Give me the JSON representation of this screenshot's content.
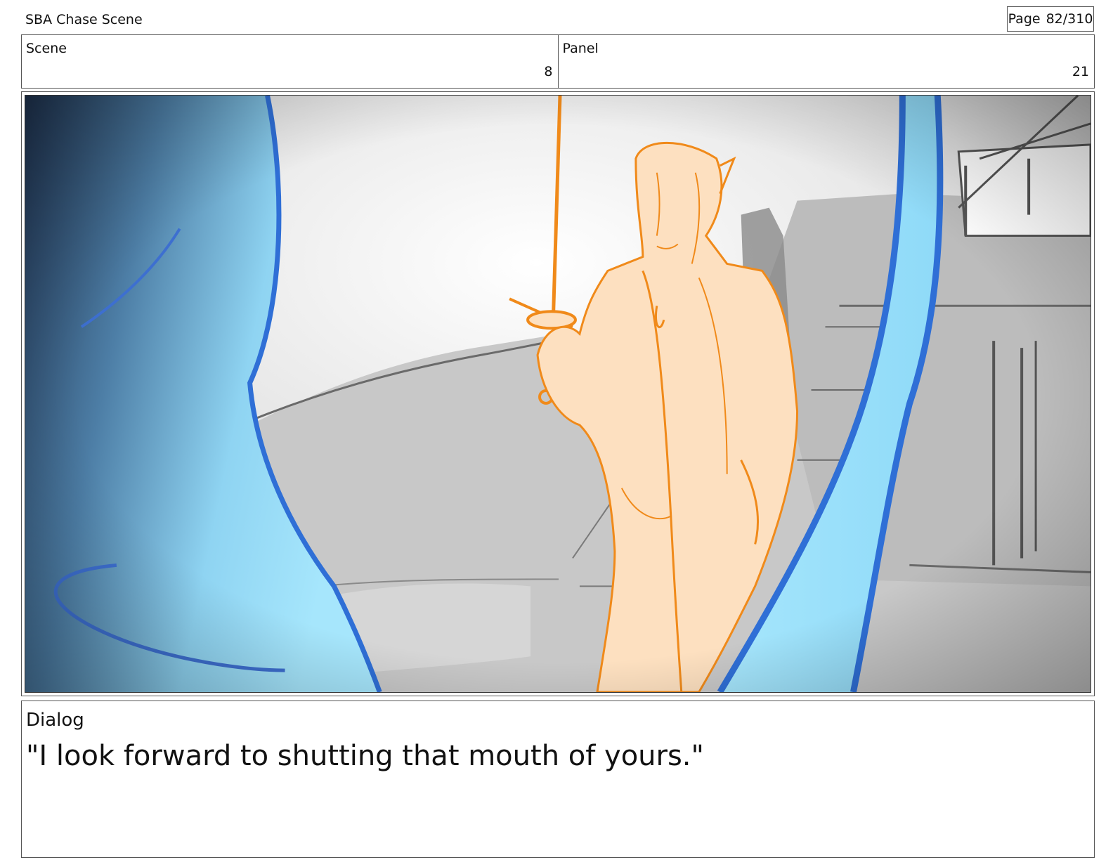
{
  "header": {
    "title": "SBA Chase Scene",
    "page_label": "Page",
    "page_number": "82/310"
  },
  "meta": {
    "scene_label": "Scene",
    "scene_value": "8",
    "panel_label": "Panel",
    "panel_value": "21"
  },
  "panel_image": {
    "palette": {
      "background_light": "#f2f2f2",
      "background_gray": "#bdbdbd",
      "foreground_blue": "#9fe0fb",
      "foreground_blue_edge": "#2f6fd6",
      "vignette_dark": "#1f3350",
      "character_fill": "#fde0c0",
      "character_line": "#f08a1a"
    }
  },
  "dialog": {
    "label": "Dialog",
    "text": "\"I look forward to shutting that mouth of yours.\""
  }
}
